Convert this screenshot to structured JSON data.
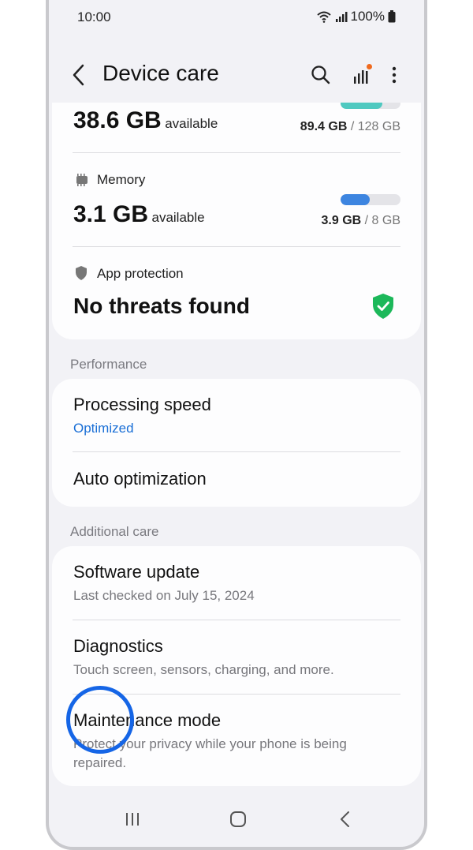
{
  "status": {
    "time": "10:00",
    "battery": "100%"
  },
  "header": {
    "title": "Device care",
    "icons": {
      "back": "chevron-left-icon",
      "search": "search-icon",
      "stats": "signal-bars-icon",
      "more": "more-vertical-icon"
    },
    "notification_dot_color": "#f06a1d"
  },
  "storage": {
    "amount": "38.6 GB",
    "available_label": "available",
    "used": "89.4 GB",
    "total": "/ 128 GB",
    "used_fraction": 0.7,
    "bar_color": "#4fc9c0"
  },
  "memory": {
    "label": "Memory",
    "amount": "3.1 GB",
    "available_label": "available",
    "used": "3.9 GB",
    "total": "/ 8 GB",
    "used_fraction": 0.49,
    "bar_color": "#3d85e0"
  },
  "app_protection": {
    "label": "App protection",
    "status": "No threats found",
    "shield_color": "#1cb85a"
  },
  "performance": {
    "section_label": "Performance",
    "processing_speed": {
      "title": "Processing speed",
      "value": "Optimized",
      "value_color": "#1a6fd6"
    },
    "auto_optimization": {
      "title": "Auto optimization"
    }
  },
  "additional_care": {
    "section_label": "Additional care",
    "software_update": {
      "title": "Software update",
      "subtitle": "Last checked on July 15, 2024"
    },
    "diagnostics": {
      "title": "Diagnostics",
      "subtitle": "Touch screen, sensors, charging, and more."
    },
    "maintenance_mode": {
      "title": "Maintenance mode",
      "subtitle": "Protect your privacy while your phone is being repaired."
    }
  },
  "navbar": {
    "icons": [
      "recents-icon",
      "home-icon",
      "back-nav-icon"
    ]
  }
}
